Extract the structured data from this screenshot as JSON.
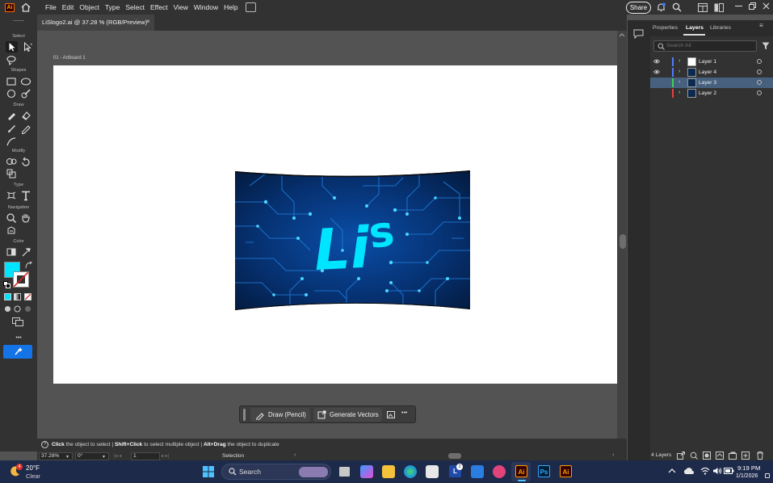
{
  "app": {
    "menus": [
      "File",
      "Edit",
      "Object",
      "Type",
      "Select",
      "Effect",
      "View",
      "Window",
      "Help"
    ],
    "share_label": "Share",
    "logo_text": "Ai"
  },
  "document": {
    "tab_title": "LiSlogo2.ai @ 37.28 % (RGB/Preview)",
    "close_glyph": "×",
    "artboard_label": "01 - Artboard 1"
  },
  "toolbar": {
    "sections": [
      "Select",
      "Shapes",
      "Draw",
      "Modify",
      "Type",
      "Navigation",
      "Color"
    ],
    "more_glyph": "•••",
    "fill_color": "#00e5ff"
  },
  "artwork": {
    "logo_text": "Li",
    "logo_text_s": "s",
    "text_color": "#00e5ff"
  },
  "context_bar": {
    "draw_label": "Draw (Pencil)",
    "generate_label": "Generate Vectors",
    "more_glyph": "•••"
  },
  "hint": {
    "part1_bold": "Click",
    "part1": " the object to select  |  ",
    "part2_bold": "Shift+Click",
    "part2": " to select multiple object  |  ",
    "part3_bold": "Alt+Drag",
    "part3": " the object to duplicate",
    "help_glyph": "?"
  },
  "status": {
    "zoom": "37.28%",
    "rotation": "0°",
    "artboard_num": "1",
    "tool": "Selection"
  },
  "panel": {
    "tabs": [
      "Properties",
      "Layers",
      "Libraries"
    ],
    "search_placeholder": "Search All",
    "layers": [
      {
        "name": "Layer 1",
        "color": "#4f7cff",
        "visible": true,
        "selected": false
      },
      {
        "name": "Layer 4",
        "color": "#4f7cff",
        "visible": true,
        "selected": false
      },
      {
        "name": "Layer 3",
        "color": "#3ed15a",
        "visible": false,
        "selected": true
      },
      {
        "name": "Layer 2",
        "color": "#e84040",
        "visible": false,
        "selected": false
      }
    ],
    "layers_count": "4 Layers"
  },
  "taskbar": {
    "weather_badge": "4",
    "weather_temp": "20°F",
    "weather_desc": "Clear",
    "search_label": "Search",
    "app_ai": "Ai",
    "app_ps": "Ps",
    "app_l": "L",
    "app_l_badge": "2",
    "time": "9:19 PM",
    "date": "1/1/2026"
  }
}
